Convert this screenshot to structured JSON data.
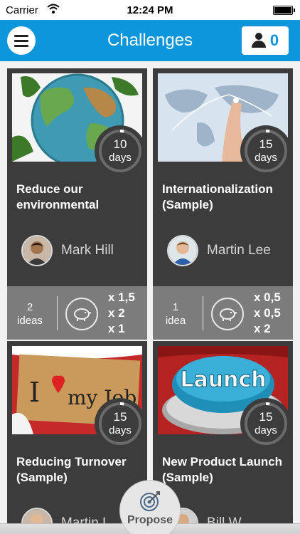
{
  "status_bar": {
    "carrier": "Carrier",
    "time": "12:24 PM"
  },
  "nav": {
    "title": "Challenges",
    "user_count": "0",
    "menu_icon": "hamburger-icon",
    "user_icon": "user-icon"
  },
  "cards": [
    {
      "days": "10",
      "days_label": "days",
      "title": "Reduce our environmental",
      "owner": "Mark Hill",
      "ideas_count": "2",
      "ideas_label": "ideas",
      "multipliers": [
        "x 1,5",
        "x 2",
        "x 1"
      ],
      "days_progress": 0.03
    },
    {
      "days": "15",
      "days_label": "days",
      "title": "Internationalization (Sample)",
      "owner": "Martin Lee",
      "ideas_count": "1",
      "ideas_label": "idea",
      "multipliers": [
        "x 0,5",
        "x 0,5",
        "x 2"
      ],
      "days_progress": 0.03
    },
    {
      "days": "15",
      "days_label": "days",
      "title": "Reducing Turnover (Sample)",
      "owner": "Martin L",
      "days_progress": 0.03
    },
    {
      "days": "15",
      "days_label": "days",
      "title": "New Product Launch (Sample)",
      "owner": "Bill W",
      "days_progress": 0.03
    }
  ],
  "images": {
    "card3_text_a": "I",
    "card3_text_b": "my Job",
    "card4_text": "Launch"
  },
  "propose": {
    "label": "Propose",
    "icon": "target-icon"
  },
  "colors": {
    "accent": "#0e96dd",
    "card_bg": "#3c3c3c",
    "stats_bg": "#7c7c7c"
  }
}
